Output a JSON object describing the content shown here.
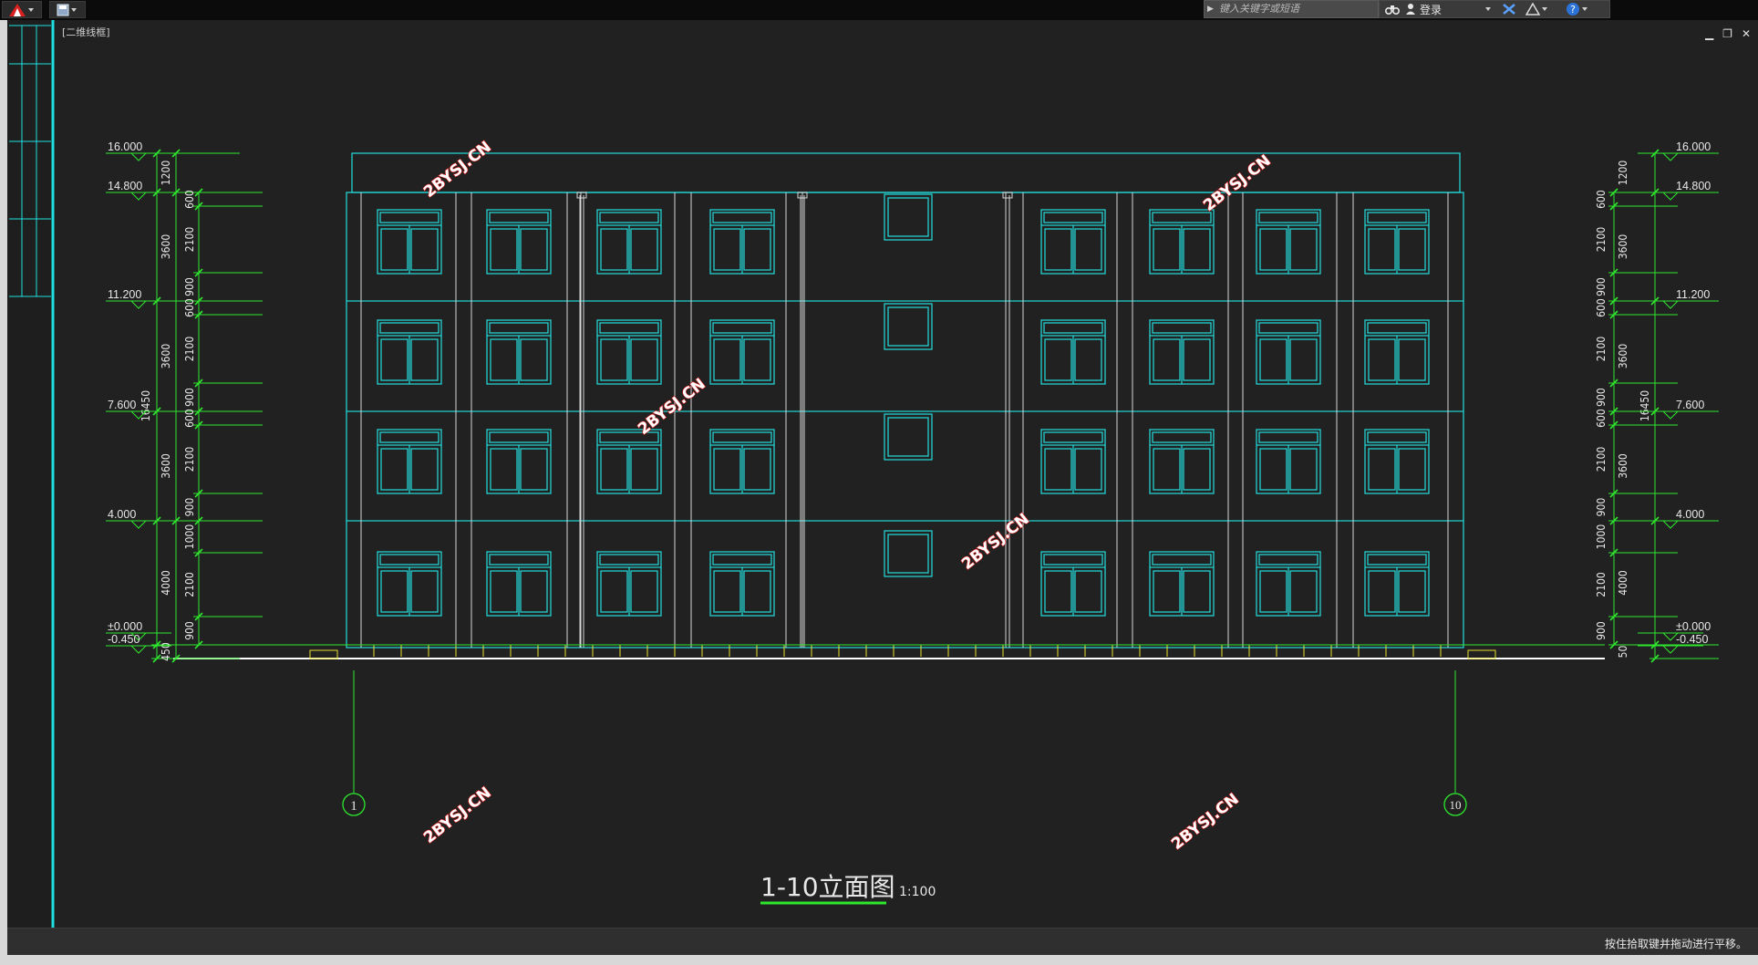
{
  "titlebar": {
    "search_placeholder": "键入关键字或短语",
    "login_label": "登录"
  },
  "view_label": "[二维线框]",
  "status_text": "按住拾取键并拖动进行平移。",
  "drawing": {
    "title": "1-10立面图",
    "scale": "1:100",
    "axis_left": "1",
    "axis_right": "10",
    "watermark": "2BYSJ.CN",
    "levels_left": [
      "16.000",
      "14.800",
      "11.200",
      "7.600",
      "4.000",
      "±0.000",
      "-0.450"
    ],
    "levels_right": [
      "16.000",
      "14.800",
      "11.200",
      "7.600",
      "4.000",
      "±0.000",
      "-0.450"
    ],
    "dims_outer_left": [
      "1200",
      "3600",
      "3600",
      "3600",
      "4000",
      "450"
    ],
    "dims_inner_left": [
      "600",
      "2100",
      "900",
      "600",
      "2100",
      "900",
      "600",
      "2100",
      "900",
      "1000",
      "2100",
      "900"
    ],
    "dims_outer_right": [
      "1200",
      "3600",
      "3600",
      "3600",
      "4000",
      "50"
    ],
    "dims_inner_right": [
      "600",
      "2100",
      "900",
      "600",
      "2100",
      "900",
      "600",
      "2100",
      "900",
      "1000",
      "2100",
      "900"
    ],
    "total_dim": "16450"
  }
}
